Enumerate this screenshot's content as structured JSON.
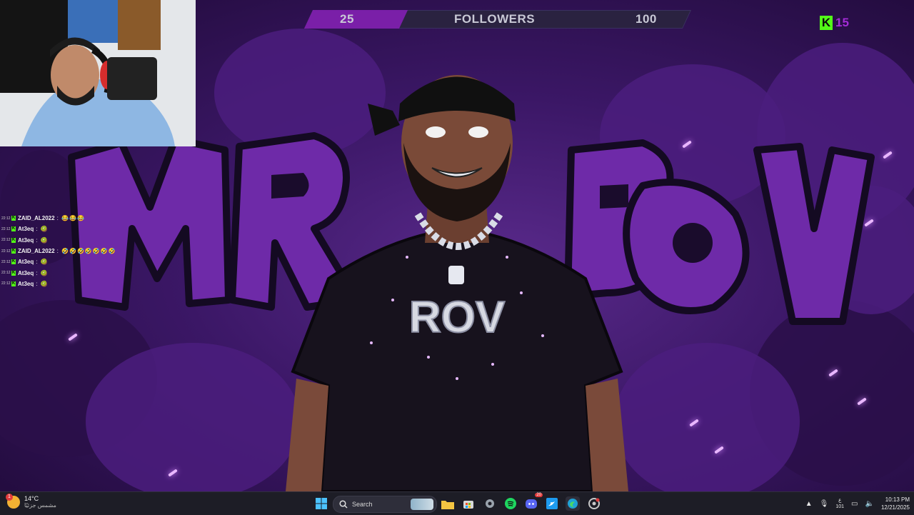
{
  "follower_goal": {
    "current": "25",
    "label": "FOLLOWERS",
    "target": "100",
    "progress": 0.25
  },
  "kick_badge": {
    "letter": "K",
    "count": "15"
  },
  "shirt_text": "ROV",
  "chat": [
    {
      "time": "22:12",
      "user": "ZAID_AL2022",
      "msg": "😂😂😂"
    },
    {
      "time": "22:12",
      "user": "At3eq",
      "msg": "🥝"
    },
    {
      "time": "22:12",
      "user": "At3eq",
      "msg": "🥝"
    },
    {
      "time": "22:12",
      "user": "ZAID_AL2022",
      "msg": "🤣🤣🤣🤣🤣🤣🤣"
    },
    {
      "time": "22:12",
      "user": "At3eq",
      "msg": "🥝"
    },
    {
      "time": "22:12",
      "user": "At3eq",
      "msg": "🥝"
    },
    {
      "time": "22:12",
      "user": "At3eq",
      "msg": "🥝"
    }
  ],
  "taskbar": {
    "weather_temp": "14°C",
    "weather_cond": "مشمس جزئيًا",
    "weather_badge": "1",
    "search_label": "Search",
    "discord_badge": "20",
    "lang_top": "ع",
    "lang_bottom": "101",
    "time": "10:13 PM",
    "date": "12/21/2025"
  },
  "colors": {
    "accent_purple": "#7a1fa8",
    "kick_green": "#53fc18",
    "taskbar_bg": "#1d1d26"
  }
}
